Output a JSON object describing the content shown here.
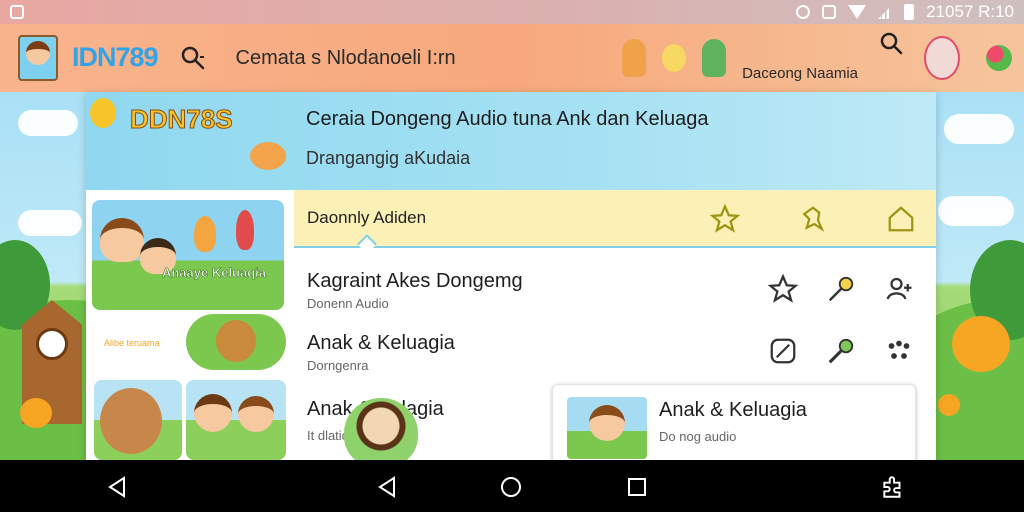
{
  "status_bar": {
    "time": "21057 R:10"
  },
  "app_bar": {
    "logo": "IDN789",
    "logo_tagline": "",
    "search_title": "Cemata s Nlodanoeli I:rn",
    "user_label": "Daceong Naamia"
  },
  "hero": {
    "logo_text": "DDN78S",
    "logo_sub": "",
    "title": "Ceraia Dongeng Audio tuna Ank dan Keluaga",
    "subtitle": "Drangangig aKudaia"
  },
  "sidebar": {
    "thumb1_label": "Anaaye Keluaqia",
    "thumb2_label": "Alibe teruama"
  },
  "tabbar": {
    "label": "Daonnly Adiden"
  },
  "rows": [
    {
      "title": "Kagraint Akes Dongemg",
      "subtitle": "Donenn Audio"
    },
    {
      "title": "Anak & Keluagia",
      "subtitle": "Dorngenra"
    }
  ],
  "cards": [
    {
      "title": "Anak & Kelagia",
      "subtitle": "It dlatio"
    },
    {
      "title": "Anak & Keluagia",
      "subtitle": "Do nog audio"
    }
  ],
  "colors": {
    "app_bar": "#f7a87c",
    "hero": "#a6e1f3",
    "tabbar": "#fbf1b6",
    "accent_icon": "#a09414",
    "navbar": "#000000"
  },
  "icons": [
    "search-icon",
    "star-icon",
    "badge-icon",
    "home-icon",
    "edit-icon",
    "dropper-icon",
    "person-add-icon",
    "more-icon",
    "back-icon",
    "home-circle-icon",
    "recents-icon",
    "extension-icon"
  ]
}
